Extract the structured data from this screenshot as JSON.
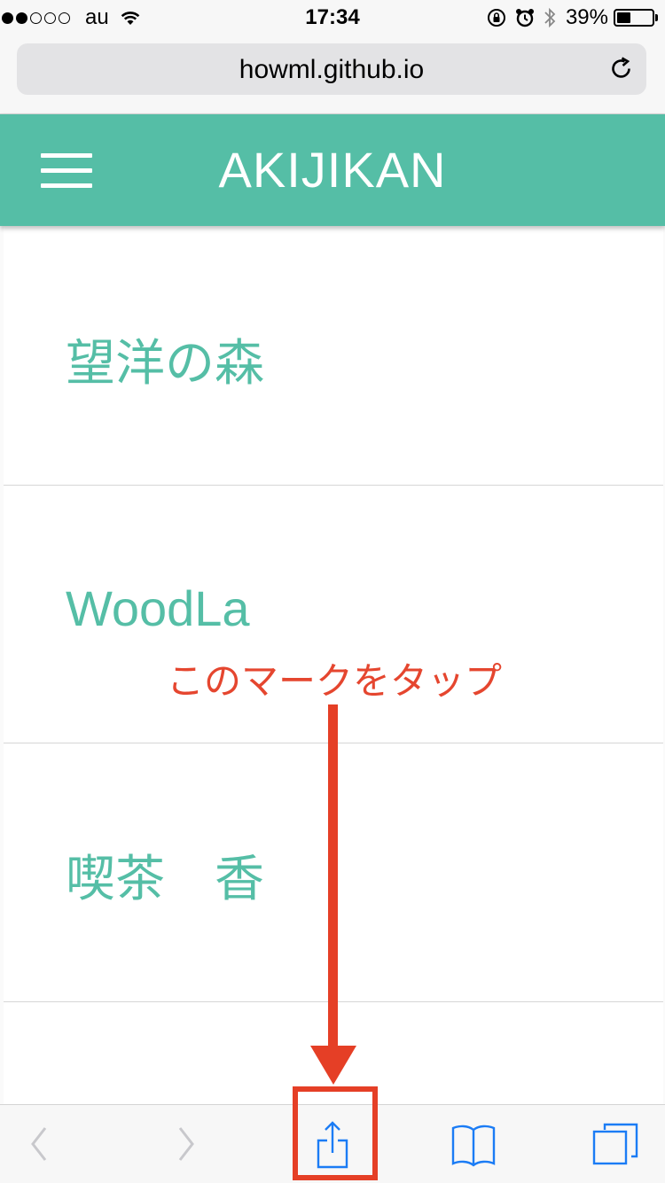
{
  "status_bar": {
    "carrier": "au",
    "time": "17:34",
    "battery_percent": "39%",
    "battery_level": 0.39,
    "signal_bars_filled": 2,
    "signal_bars_total": 5
  },
  "browser": {
    "url": "howml.github.io"
  },
  "app": {
    "title": "AKIJIKAN",
    "accent_color": "#55bea6"
  },
  "items": [
    {
      "title": "望洋の森"
    },
    {
      "title": "WoodLa"
    },
    {
      "title": "喫茶　香"
    },
    {
      "title": ""
    }
  ],
  "annotation": {
    "text": "このマークをタップ",
    "color": "#e53f26"
  },
  "toolbar": {
    "buttons": [
      "back-icon",
      "forward-icon",
      "share-icon",
      "bookmarks-icon",
      "tabs-icon"
    ]
  }
}
